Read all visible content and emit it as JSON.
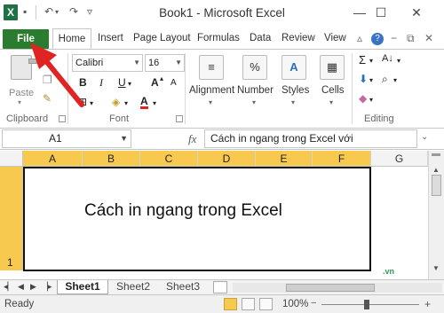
{
  "window": {
    "app_icon": "X",
    "title": "Book1 - Microsoft Excel",
    "controls": {
      "minimize": "—",
      "maximize": "☐",
      "close": "✕"
    }
  },
  "quick_access": {
    "save_icon": "save-icon",
    "undo_icon": "undo-icon",
    "redo_icon": "redo-icon"
  },
  "tabs": {
    "file": "File",
    "home": "Home",
    "insert": "Insert",
    "page_layout": "Page Layout",
    "formulas": "Formulas",
    "data": "Data",
    "review": "Review",
    "view": "View"
  },
  "ribbon": {
    "clipboard": {
      "paste": "Paste",
      "label": "Clipboard"
    },
    "font": {
      "label": "Font",
      "name": "Calibri",
      "size": "16",
      "bold": "B",
      "italic": "I",
      "underline": "U",
      "grow": "A",
      "shrink": "A",
      "font_color": "A"
    },
    "alignment": {
      "label": "Alignment",
      "icon": "≡"
    },
    "number": {
      "label": "Number",
      "icon": "%"
    },
    "styles": {
      "label": "Styles",
      "icon": "A"
    },
    "cells": {
      "label": "Cells",
      "icon": "▦"
    },
    "editing": {
      "label": "Editing",
      "sum": "Σ",
      "sort": "A↓"
    }
  },
  "formula_bar": {
    "name_box": "A1",
    "fx": "fx",
    "content": "Cách in ngang trong Excel với"
  },
  "grid": {
    "columns": [
      "A",
      "B",
      "C",
      "D",
      "E",
      "F",
      "G"
    ],
    "row_number": "1",
    "merged_text": "Cách in ngang trong Excel",
    "watermark": ".vn"
  },
  "sheets": [
    "Sheet1",
    "Sheet2",
    "Sheet3"
  ],
  "status": {
    "ready": "Ready",
    "zoom": "100%",
    "zoom_minus": "−",
    "zoom_plus": "+"
  },
  "accents": {
    "file_tab": "#2a7d2e",
    "selection": "#f7c94f",
    "arrow": "#e02424"
  }
}
